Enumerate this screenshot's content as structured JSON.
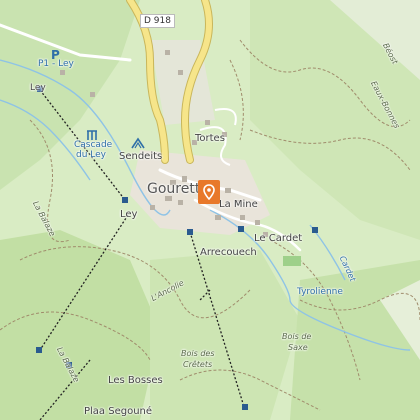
{
  "map": {
    "road_shield": "D 918",
    "places": {
      "gourette": "Gourette",
      "la_mine": "La Mine",
      "tortes": "Tortes",
      "sendeits": "Sendeits",
      "le_cardet": "Le Cardet",
      "arrecouech": "Arrecouech",
      "tyrolienne": "Tyrolienne",
      "les_bosses": "Les Bosses",
      "plaa_segoune": "Plaa Segouné",
      "cascade_line1": "Cascade",
      "cascade_line2": "du Ley",
      "ley_top": "Ley",
      "ley_mid": "Ley",
      "parking": "P1 - Ley"
    },
    "terrain": {
      "la_balaze": "La Balaze",
      "la_balaze_2": "La Balaze",
      "l_ancolie": "L'Ancolie",
      "bois_cretets_1": "Bois des",
      "bois_cretets_2": "Crêtets",
      "bois_saxe_1": "Bois de",
      "bois_saxe_2": "Saxe",
      "cardet_stream": "Cardet",
      "eaux_bonnes": "Eaux-Bonnes",
      "col_aubisque": "Béost"
    },
    "icons": [
      "parking-icon",
      "waterfall-icon",
      "viewpoint-icon",
      "location-pin-icon"
    ],
    "colors": {
      "background": "#d9ecc4",
      "forest": "#c3e0a8",
      "road_yellow": "#f6e58a",
      "pin": "#e8782a",
      "water": "#8ec3e6"
    }
  }
}
